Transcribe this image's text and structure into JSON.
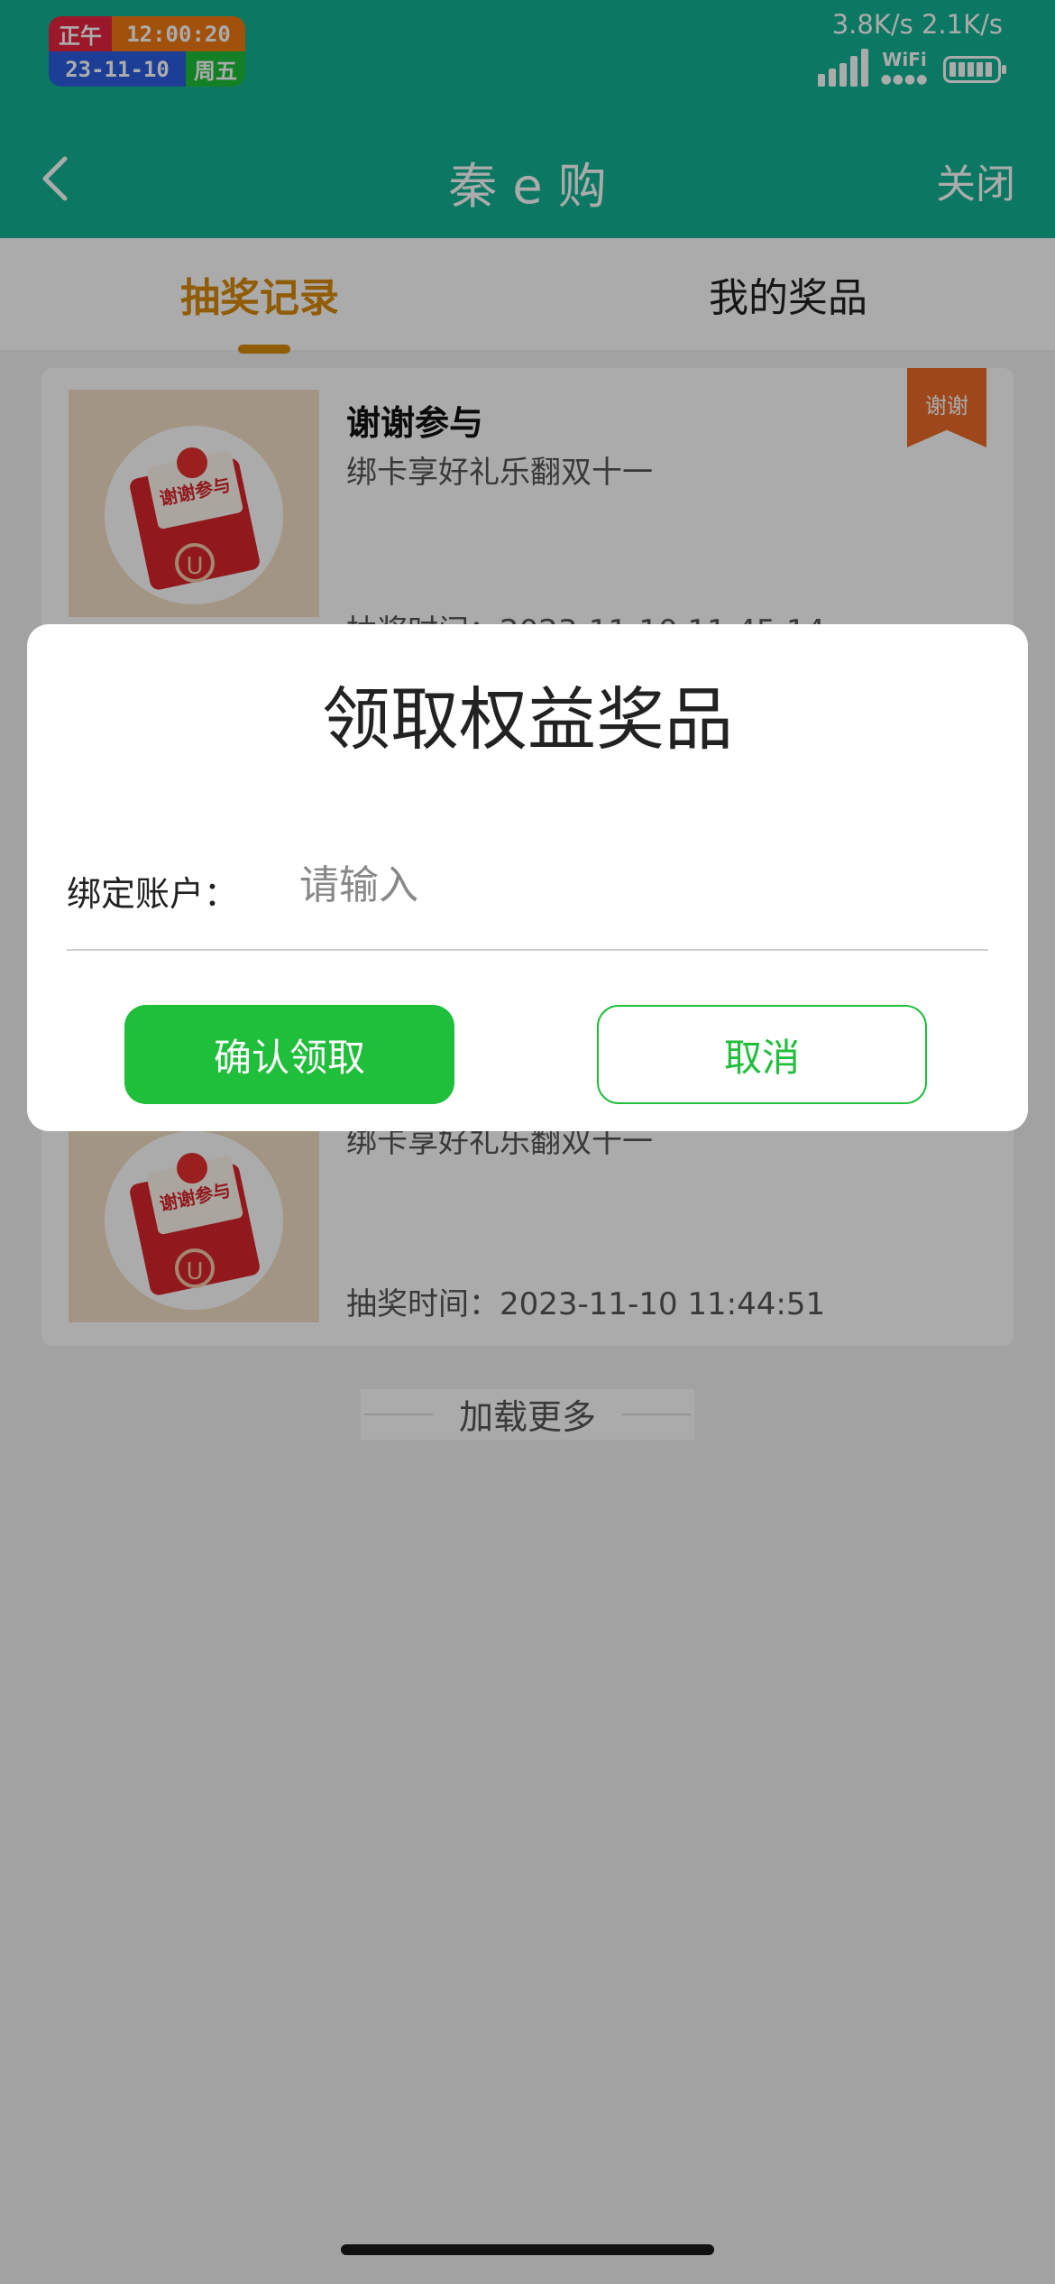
{
  "status_bar": {
    "period": "正午",
    "time": "12:00:20",
    "date": "23-11-10",
    "weekday": "周五",
    "net_speed": "3.8K/s 2.1K/s",
    "wifi_label": "WiFi",
    "signal_icon": "signal-bars-icon",
    "battery_icon": "battery-icon"
  },
  "nav": {
    "title": "秦 e 购",
    "close_label": "关闭",
    "back_icon": "chevron-left-icon"
  },
  "tabs": [
    {
      "label": "抽奖记录",
      "active": true
    },
    {
      "label": "我的奖品",
      "active": false
    }
  ],
  "records": [
    {
      "title": "谢谢参与",
      "subtitle": "绑卡享好礼乐翻双十一",
      "time": "抽奖时间：2023-11-10 11:45:14",
      "badge": "谢谢",
      "thumb_text": "谢谢参与"
    },
    {
      "title": "",
      "subtitle": "绑卡享好礼乐翻双十一",
      "time": "抽奖时间：2023-11-10 11:44:51",
      "thumb_text": "谢谢参与"
    }
  ],
  "load_more": "加载更多",
  "dialog": {
    "title": "领取权益奖品",
    "field_label": "绑定账户：",
    "placeholder": "请输入",
    "value": "",
    "confirm_label": "确认领取",
    "cancel_label": "取消"
  },
  "colors": {
    "header": "#12b394",
    "accent_tab": "#d98a0a",
    "confirm": "#1fbe3b",
    "badge": "#ea6a29"
  }
}
